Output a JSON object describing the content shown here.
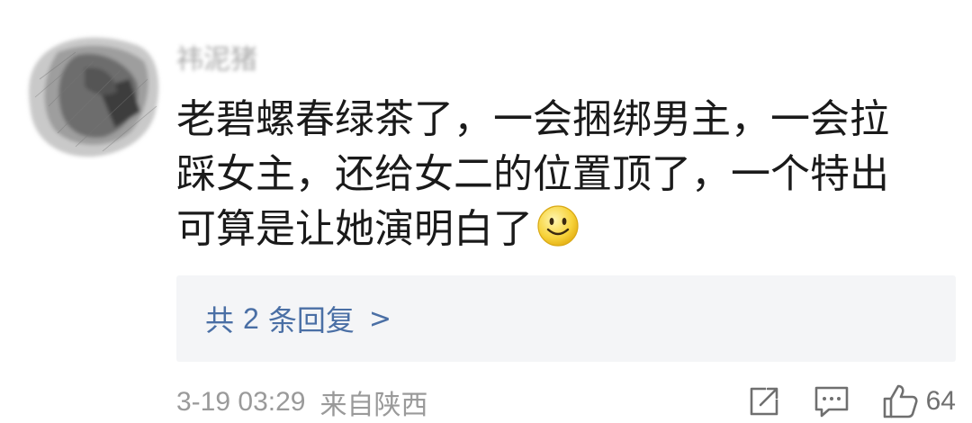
{
  "comment": {
    "username": "祎泥猪",
    "lines": [
      "老碧螺春绿茶了，一会捆绑男主，一会拉",
      "踩女主，还给女二的位置顶了，一个特出",
      "可算是让她演明白了"
    ],
    "emoji_icon": "smile-emoji-icon",
    "replies": {
      "prefix": "共",
      "count": "2",
      "suffix": "条回复",
      "chevron": ">"
    },
    "timestamp": "3-19 03:29",
    "location": "来自陕西",
    "like_count": "64",
    "action_icons": [
      "share-icon",
      "comment-icon",
      "thumbs-up-icon"
    ]
  },
  "colors": {
    "text": "#1a1a1a",
    "link": "#4a6fa5",
    "meta": "#9a9a9a",
    "reply_bg": "#f4f5f7"
  }
}
